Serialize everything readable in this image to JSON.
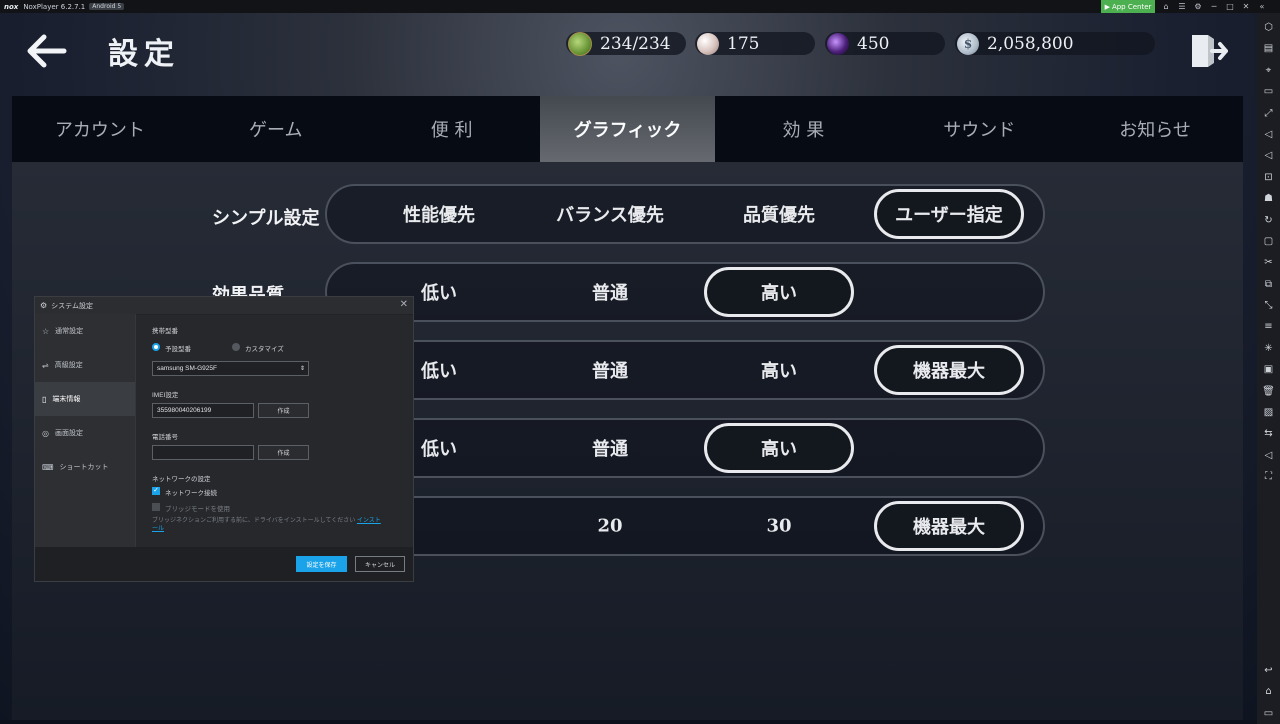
{
  "window": {
    "logo": "nox",
    "title": "NoxPlayer 6.2.7.1",
    "android_badge": "Android 5",
    "app_center": "App Center"
  },
  "header": {
    "title": "設定",
    "resources": [
      {
        "icon": "stamina-leaf-icon",
        "value": "234/234",
        "color": "#6f9a3b"
      },
      {
        "icon": "pearl-icon",
        "value": "175",
        "color": "#d9c7c2"
      },
      {
        "icon": "purple-orb-icon",
        "value": "450",
        "color": "#4b1f79"
      },
      {
        "icon": "silver-coin-icon",
        "value": "2,058,800",
        "color": "#aebbc9"
      }
    ]
  },
  "tabs": [
    {
      "label": "アカウント"
    },
    {
      "label": "ゲーム"
    },
    {
      "label": "便 利"
    },
    {
      "label": "グラフィック",
      "active": true
    },
    {
      "label": "効 果"
    },
    {
      "label": "サウンド"
    },
    {
      "label": "お知らせ"
    }
  ],
  "settings": {
    "simple_label": "シンプル設定",
    "simple_options": [
      "性能優先",
      "バランス優先",
      "品質優先",
      "ユーザー指定"
    ],
    "effect_label": "効果品質",
    "effect_options": [
      "低い",
      "普通",
      "高い"
    ],
    "row3_options": [
      "低い",
      "普通",
      "高い",
      "機器最大"
    ],
    "row4_options": [
      "低い",
      "普通",
      "高い"
    ],
    "row5_options": [
      "20",
      "30",
      "機器最大"
    ]
  },
  "dialog": {
    "title": "システム設定",
    "nav": [
      {
        "label": "通常設定",
        "icon": "star-icon"
      },
      {
        "label": "高級設定",
        "icon": "sliders-icon"
      },
      {
        "label": "端末情報",
        "icon": "device-icon",
        "active": true
      },
      {
        "label": "画面設定",
        "icon": "display-icon"
      },
      {
        "label": "ショートカット",
        "icon": "keyboard-icon"
      }
    ],
    "model_label": "携帯型番",
    "radio_preset": "予設型番",
    "radio_custom": "カスタマイズ",
    "model_value": "samsung SM-G925F",
    "imei_label": "IMEI設定",
    "imei_value": "355980040206199",
    "generate_label": "作成",
    "phone_label": "電話番号",
    "network_label": "ネットワークの設定",
    "network_connect": "ネットワーク接続",
    "bridge_mode": "ブリッジモードを使用",
    "bridge_note": "ブリッジネクションご利用する前に、ドライバをインストールしてください",
    "install_link_1": "インスト",
    "install_link_2": "ール",
    "save": "設定を保存",
    "cancel": "キャンセル"
  }
}
